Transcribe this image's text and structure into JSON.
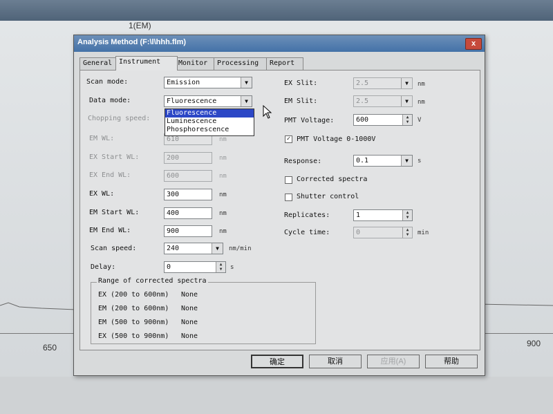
{
  "background": {
    "plot_title": "1(EM)",
    "axis_ticks": [
      "650",
      "900"
    ]
  },
  "dialog": {
    "title": "Analysis Method (F:\\l\\hhh.flm)",
    "close": "x",
    "tabs": [
      "General",
      "Instrument",
      "Monitor",
      "Processing",
      "Report"
    ],
    "active_tab": "Instrument"
  },
  "left": {
    "scan_mode": {
      "label": "Scan mode:",
      "value": "Emission"
    },
    "data_mode": {
      "label": "Data mode:",
      "value": "Fluorescence",
      "options": [
        "Fluorescence",
        "Luminescence",
        "Phosphorescence"
      ],
      "selected": "Fluorescence"
    },
    "chopping_speed": {
      "label": "Chopping speed:"
    },
    "em_wl": {
      "label": "EM WL:",
      "value": "610",
      "unit": "nm"
    },
    "ex_start_wl": {
      "label": "EX Start WL:",
      "value": "200",
      "unit": "nm"
    },
    "ex_end_wl": {
      "label": "EX End WL:",
      "value": "600",
      "unit": "nm"
    },
    "ex_wl": {
      "label": "EX WL:",
      "value": "300",
      "unit": "nm"
    },
    "em_start_wl": {
      "label": "EM Start WL:",
      "value": "400",
      "unit": "nm"
    },
    "em_end_wl": {
      "label": "EM End WL:",
      "value": "900",
      "unit": "nm"
    },
    "scan_speed": {
      "label": "Scan speed:",
      "value": "240",
      "unit": "nm/min"
    },
    "delay": {
      "label": "Delay:",
      "value": "0",
      "unit": "s"
    }
  },
  "right": {
    "ex_slit": {
      "label": "EX Slit:",
      "value": "2.5",
      "unit": "nm"
    },
    "em_slit": {
      "label": "EM Slit:",
      "value": "2.5",
      "unit": "nm"
    },
    "pmt_voltage": {
      "label": "PMT Voltage:",
      "value": "600",
      "unit": "V"
    },
    "pmt_range": {
      "label": "PMT Voltage 0-1000V",
      "checked": true
    },
    "response": {
      "label": "Response:",
      "value": "0.1",
      "unit": "s"
    },
    "corrected_spectra": {
      "label": "Corrected spectra",
      "checked": false
    },
    "shutter_control": {
      "label": "Shutter control",
      "checked": false
    },
    "replicates": {
      "label": "Replicates:",
      "value": "1"
    },
    "cycle_time": {
      "label": "Cycle time:",
      "value": "0",
      "unit": "min"
    }
  },
  "range_group": {
    "title": "Range of corrected spectra",
    "rows": [
      {
        "range": "EX (200 to 600nm)",
        "status": "None"
      },
      {
        "range": "EM (200 to 600nm)",
        "status": "None"
      },
      {
        "range": "EM (500 to 900nm)",
        "status": "None"
      },
      {
        "range": "EX (500 to 900nm)",
        "status": "None"
      }
    ]
  },
  "buttons": {
    "ok": "确定",
    "cancel": "取消",
    "apply": "应用(A)",
    "help": "帮助"
  },
  "check_mark": "✓",
  "colors": {
    "title_bar": "#4472a8",
    "selection": "#2c47c6",
    "close": "#c64a3c"
  }
}
